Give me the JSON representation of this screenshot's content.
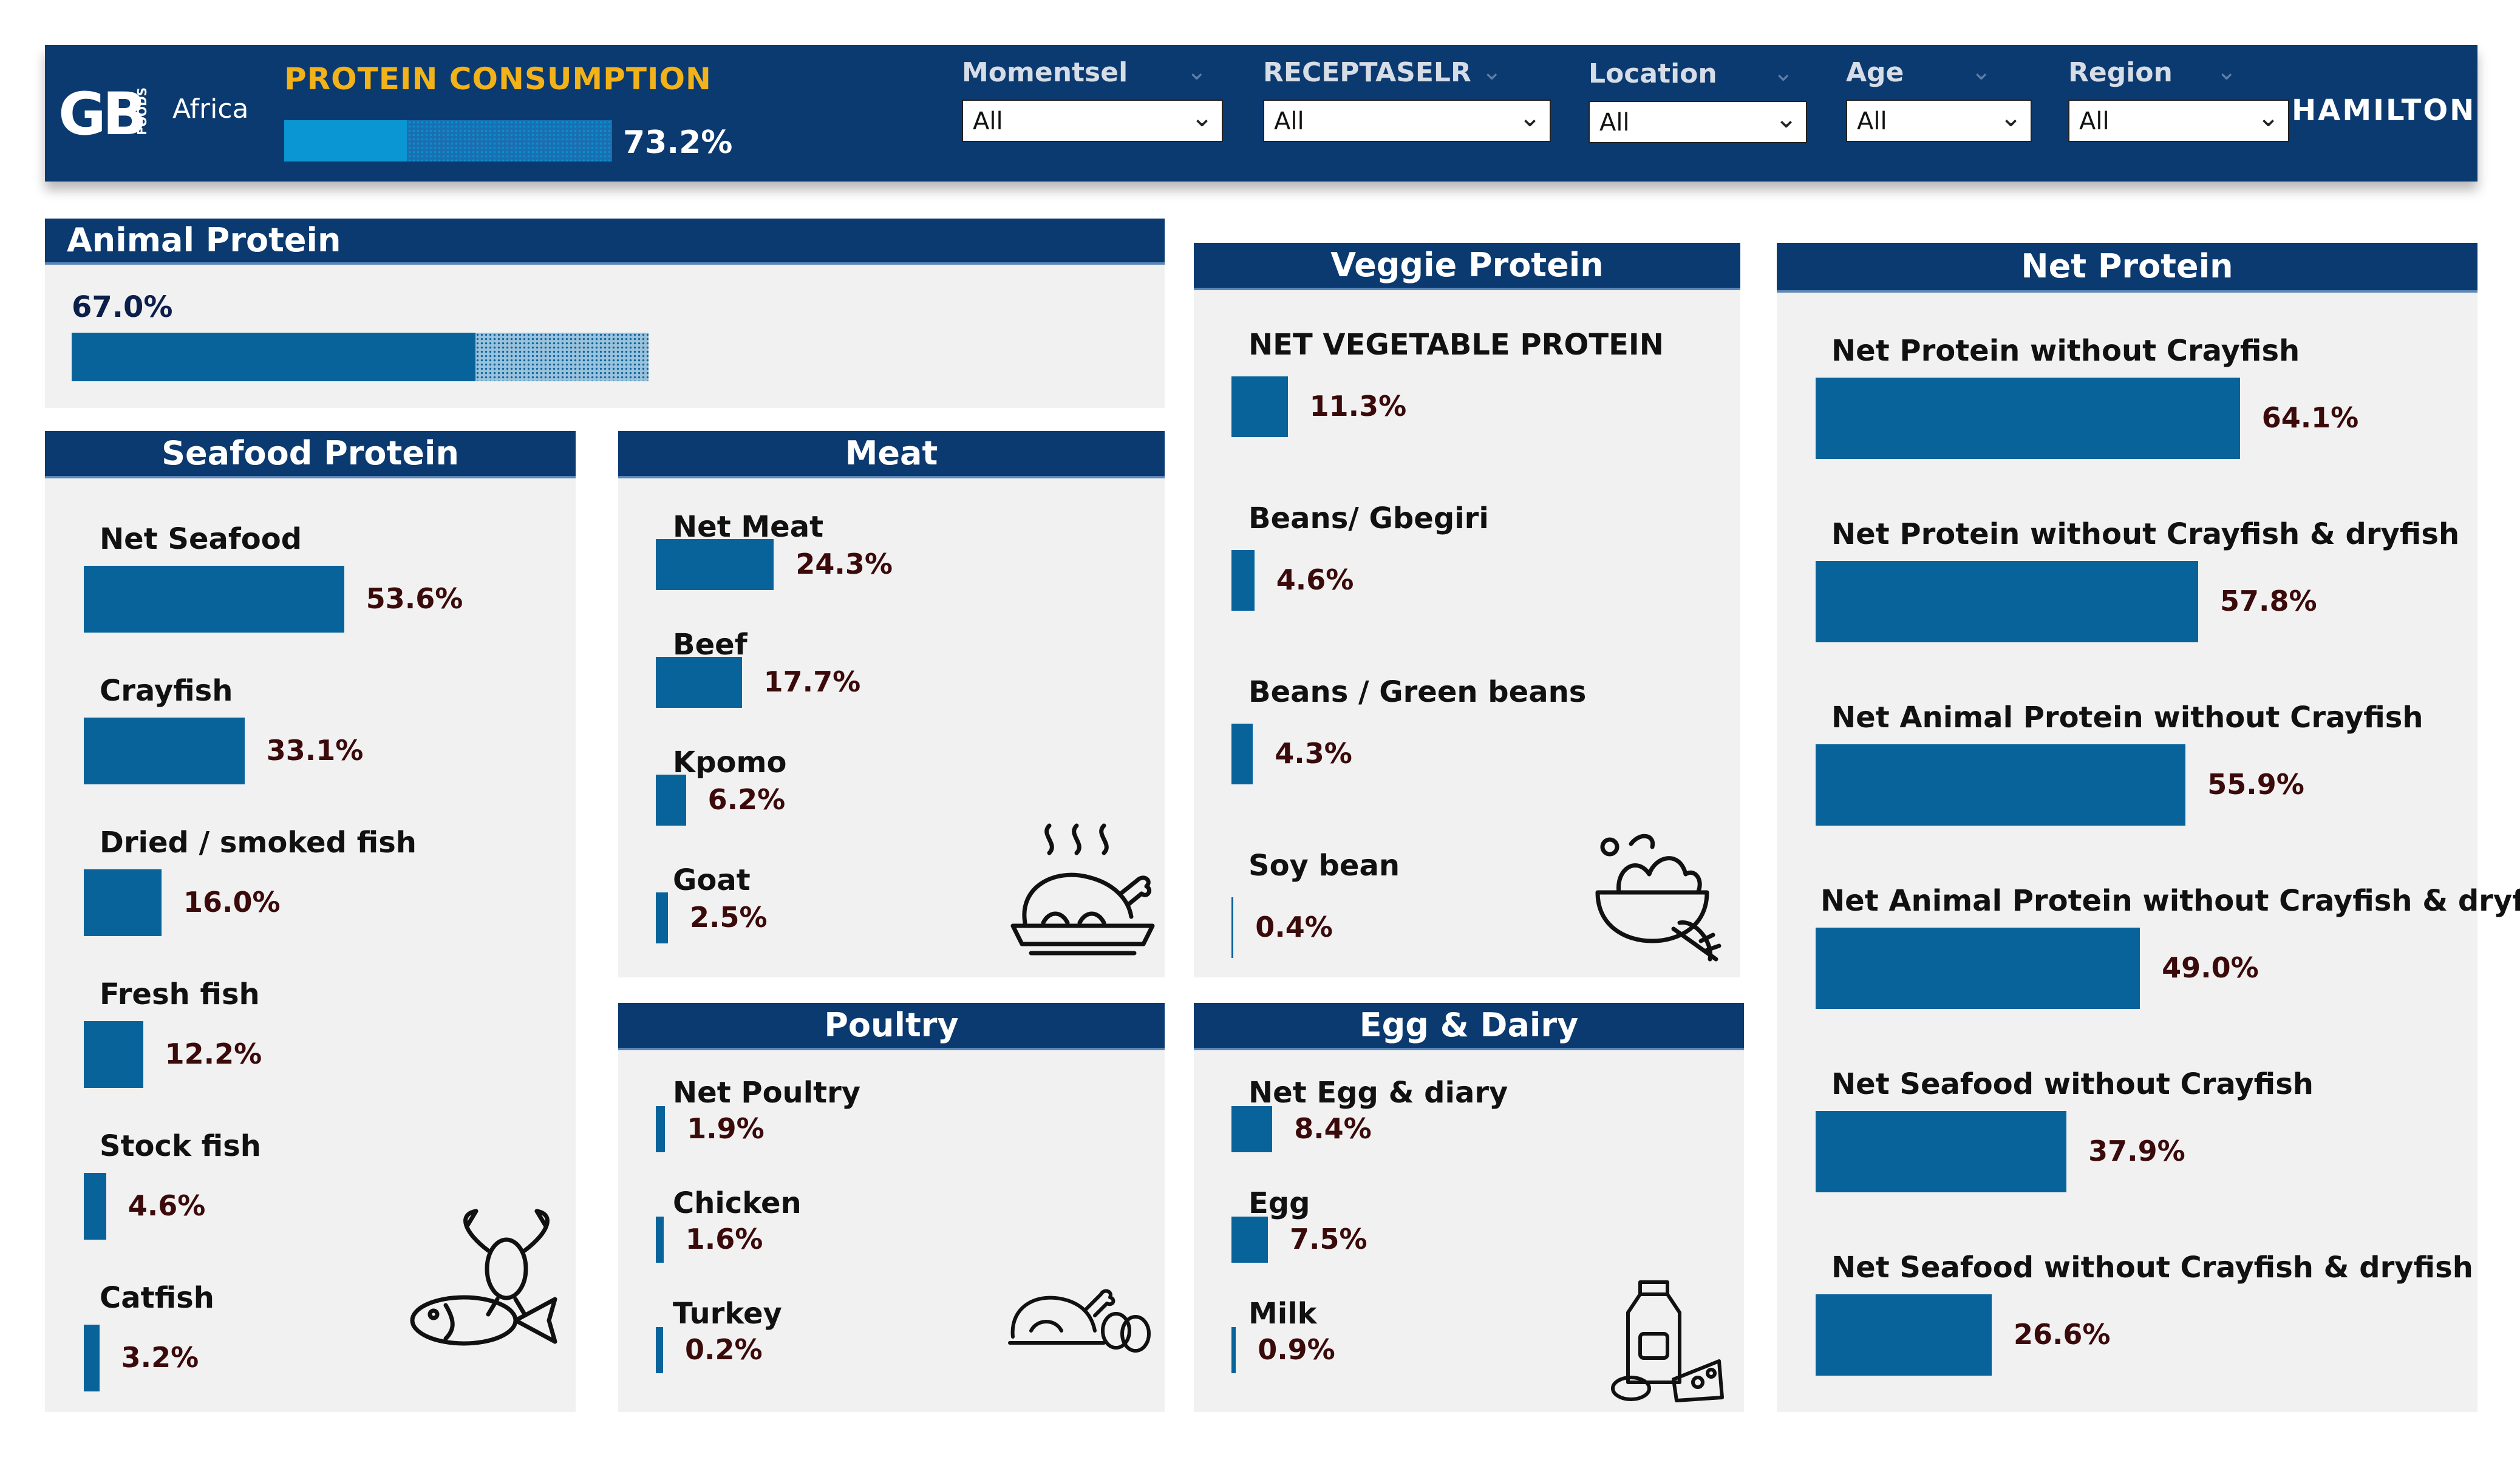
{
  "header": {
    "logo_text": "GB",
    "logo_foods": "FOODS",
    "logo_region": "Africa",
    "title": "PROTEIN CONSUMPTION",
    "progress": 73.2,
    "progress_label": "73.2%",
    "filters": [
      {
        "label": "Momentsel",
        "value": "All"
      },
      {
        "label": "RECEPTASELR",
        "value": "All"
      },
      {
        "label": "Location",
        "value": "All"
      },
      {
        "label": "Age",
        "value": "All"
      },
      {
        "label": "Region",
        "value": "All"
      }
    ],
    "city": "HAMILTON"
  },
  "colors": {
    "header_bg": "#0b3a70",
    "title_accent": "#f2b21a",
    "bar": "#08639b",
    "value_text": "#3b0a0a",
    "panel_bg": "#f1f1f1"
  },
  "animal": {
    "title": "Animal Protein",
    "value": 67.0,
    "value_label": "67.0%"
  },
  "seafood": {
    "title": "Seafood Protein",
    "icon": "lobster-fish-icon",
    "items": [
      {
        "label": "Net Seafood",
        "value": 53.6,
        "value_label": "53.6%"
      },
      {
        "label": "Crayfish",
        "value": 33.1,
        "value_label": "33.1%"
      },
      {
        "label": "Dried / smoked fish",
        "value": 16.0,
        "value_label": "16.0%"
      },
      {
        "label": "Fresh fish",
        "value": 12.2,
        "value_label": "12.2%"
      },
      {
        "label": "Stock fish",
        "value": 4.6,
        "value_label": "4.6%"
      },
      {
        "label": "Catfish",
        "value": 3.2,
        "value_label": "3.2%"
      }
    ]
  },
  "meat": {
    "title": "Meat",
    "icon": "roast-chicken-icon",
    "items": [
      {
        "label": "Net Meat",
        "value": 24.3,
        "value_label": "24.3%"
      },
      {
        "label": "Beef",
        "value": 17.7,
        "value_label": "17.7%"
      },
      {
        "label": "Kpomo",
        "value": 6.2,
        "value_label": "6.2%"
      },
      {
        "label": "Goat",
        "value": 2.5,
        "value_label": "2.5%"
      }
    ]
  },
  "poultry": {
    "title": "Poultry",
    "icon": "chicken-eggs-icon",
    "items": [
      {
        "label": "Net Poultry",
        "value": 1.9,
        "value_label": "1.9%"
      },
      {
        "label": "Chicken",
        "value": 1.6,
        "value_label": "1.6%"
      },
      {
        "label": "Turkey",
        "value": 0.2,
        "value_label": "0.2%"
      }
    ]
  },
  "veggie": {
    "title": "Veggie Protein",
    "icon": "salad-bowl-icon",
    "items": [
      {
        "label": "NET VEGETABLE PROTEIN",
        "value": 11.3,
        "value_label": "11.3%"
      },
      {
        "label": "Beans/ Gbegiri",
        "value": 4.6,
        "value_label": "4.6%"
      },
      {
        "label": "Beans / Green beans",
        "value": 4.3,
        "value_label": "4.3%"
      },
      {
        "label": "Soy bean",
        "value": 0.4,
        "value_label": "0.4%"
      }
    ]
  },
  "egg": {
    "title": "Egg & Dairy",
    "icon": "milk-cheese-icon",
    "items": [
      {
        "label": "Net Egg & diary",
        "value": 8.4,
        "value_label": "8.4%"
      },
      {
        "label": "Egg",
        "value": 7.5,
        "value_label": "7.5%"
      },
      {
        "label": "Milk",
        "value": 0.9,
        "value_label": "0.9%"
      }
    ]
  },
  "net": {
    "title": "Net Protein",
    "items": [
      {
        "label": "Net Protein without Crayfish",
        "value": 64.1,
        "value_label": "64.1%"
      },
      {
        "label": "Net Protein without Crayfish & dryfish",
        "value": 57.8,
        "value_label": "57.8%"
      },
      {
        "label": "Net Animal Protein without Crayfish",
        "value": 55.9,
        "value_label": "55.9%"
      },
      {
        "label": "Net Animal Protein without Crayfish & dryfish",
        "value": 49.0,
        "value_label": "49.0%"
      },
      {
        "label": "Net Seafood without Crayfish",
        "value": 37.9,
        "value_label": "37.9%"
      },
      {
        "label": "Net Seafood without Crayfish & dryfish",
        "value": 26.6,
        "value_label": "26.6%"
      }
    ]
  }
}
